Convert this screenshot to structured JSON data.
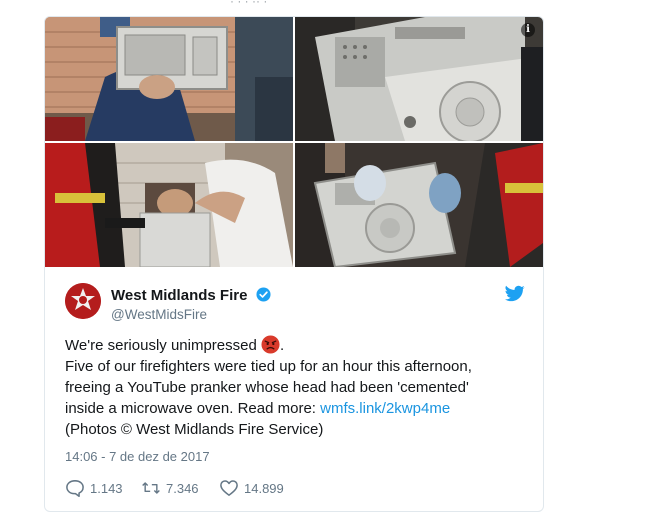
{
  "top_clip_text": "· ·   · ··  ·",
  "media": {
    "photos": [
      "photo-1",
      "photo-2",
      "photo-3",
      "photo-4"
    ],
    "info_label": "i"
  },
  "author": {
    "name": "West Midlands Fire",
    "handle": "@WestMidsFire",
    "verified": true
  },
  "tweet": {
    "line1": "We're seriously unimpressed",
    "line1_end": ".",
    "line2": "Five of our firefighters were tied up for an hour this afternoon,",
    "line3": "freeing a YouTube pranker whose head had been 'cemented'",
    "line4_prefix": "inside a microwave oven. Read more: ",
    "link": "wmfs.link/2kwp4me",
    "line5": "(Photos © West Midlands Fire Service)"
  },
  "timestamp": "14:06 - 7 de dez de 2017",
  "stats": {
    "replies": "1.143",
    "retweets": "7.346",
    "likes": "14.899"
  },
  "colors": {
    "link": "#1b95e0",
    "verified": "#1da1f2",
    "muted": "#657786",
    "brand_red": "#b41d1d"
  }
}
